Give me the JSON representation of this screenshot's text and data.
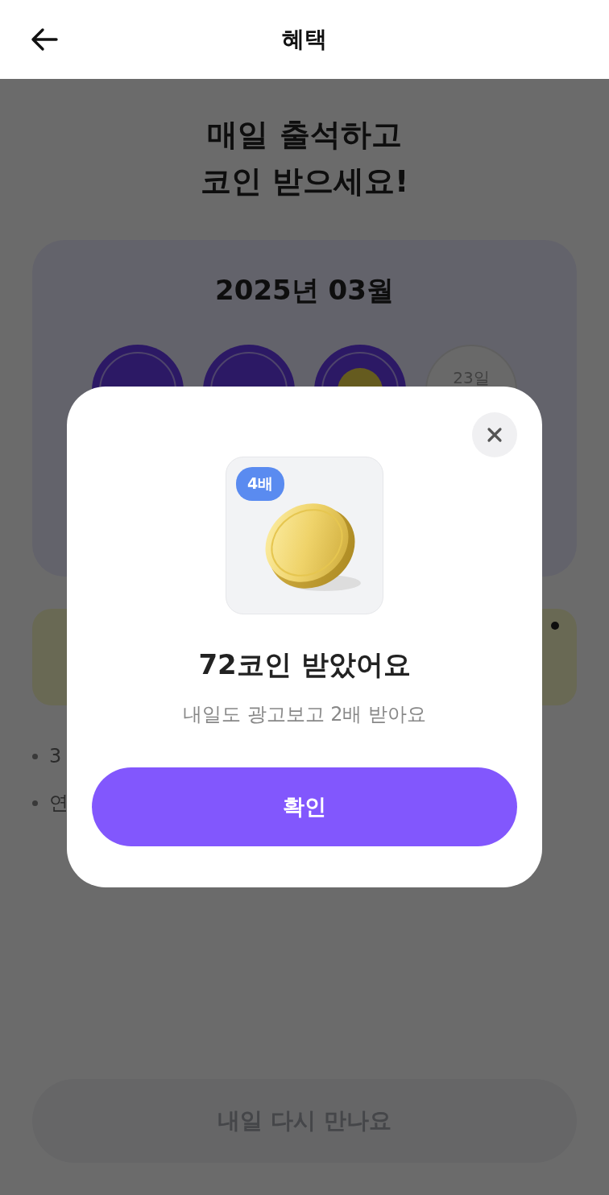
{
  "header": {
    "title": "혜택"
  },
  "headline": [
    "매일 출석하고",
    "코인 받으세요!"
  ],
  "calendar": {
    "month": "2025년 03월",
    "days": [
      {
        "kind": "stamped"
      },
      {
        "kind": "stamped"
      },
      {
        "kind": "coin"
      },
      {
        "kind": "empty",
        "label": "23일"
      }
    ]
  },
  "notes": [
    "3",
    "연"
  ],
  "bottom_button": {
    "label": "내일 다시 만나요",
    "disabled": true
  },
  "dialog": {
    "badge": "4배",
    "title": "72코인 받았어요",
    "subtitle": "내일도 광고보고 2배 받아요",
    "confirm": "확인"
  }
}
